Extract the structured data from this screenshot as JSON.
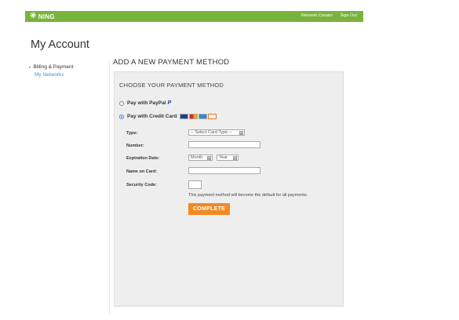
{
  "topbar": {
    "logo_text": "NING",
    "logo_icon": "ning-snowflake-icon",
    "links": [
      "Network Creator",
      "Sign Out"
    ],
    "color": "#79b33b"
  },
  "page": {
    "title": "My Account"
  },
  "sidebar": {
    "items": [
      {
        "label": "Billing & Payment",
        "active": true
      },
      {
        "label": "My Networks",
        "active": false
      }
    ]
  },
  "main": {
    "section_title": "ADD A NEW PAYMENT METHOD",
    "panel": {
      "heading": "CHOOSE YOUR PAYMENT METHOD",
      "options": [
        {
          "label": "Pay with PayPal",
          "badge": "P",
          "selected": false
        },
        {
          "label": "Pay with Credit Card",
          "selected": true,
          "card_icons": [
            "visa-card-icon",
            "mastercard-card-icon",
            "amex-card-icon",
            "discover-card-icon"
          ]
        }
      ],
      "fields": {
        "type_label": "Type:",
        "type_value": "-- Select Card Type --",
        "number_label": "Number:",
        "number_value": "",
        "expiration_label": "Expiration Date:",
        "month_value": "Month",
        "year_value": "Year",
        "name_label": "Name on Card:",
        "name_value": "",
        "security_label": "Security Code:",
        "security_value": ""
      },
      "note": "This payment method will become the default for all payments.",
      "submit_label": "COMPLETE",
      "submit_color": "#f28a1f"
    }
  }
}
